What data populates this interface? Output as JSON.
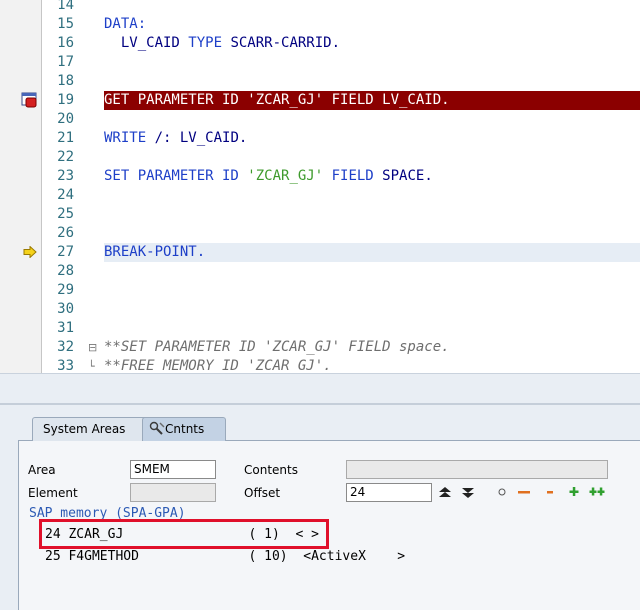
{
  "editor": {
    "lines": [
      {
        "no": "14",
        "tokens": []
      },
      {
        "no": "15",
        "tokens": [
          {
            "t": "DATA:",
            "c": "kw"
          }
        ]
      },
      {
        "no": "16",
        "tokens": [
          {
            "t": "  LV_CAID ",
            "c": "txt"
          },
          {
            "t": "TYPE",
            "c": "kw"
          },
          {
            "t": " SCARR-CARRID.",
            "c": "txt"
          }
        ]
      },
      {
        "no": "17",
        "tokens": []
      },
      {
        "no": "18",
        "tokens": []
      },
      {
        "no": "19",
        "tokens": [
          {
            "t": "GET PARAMETER ID 'ZCAR_GJ' FIELD LV_CAID.",
            "c": "txt"
          }
        ],
        "state": "breakpoint"
      },
      {
        "no": "20",
        "tokens": []
      },
      {
        "no": "21",
        "tokens": [
          {
            "t": "WRITE",
            "c": "kw"
          },
          {
            "t": " /: LV_CAID.",
            "c": "txt"
          }
        ]
      },
      {
        "no": "22",
        "tokens": []
      },
      {
        "no": "23",
        "tokens": [
          {
            "t": "SET PARAMETER ID",
            "c": "kw"
          },
          {
            "t": " ",
            "c": "txt"
          },
          {
            "t": "'ZCAR_GJ'",
            "c": "str"
          },
          {
            "t": " ",
            "c": "txt"
          },
          {
            "t": "FIELD",
            "c": "kw"
          },
          {
            "t": " SPACE.",
            "c": "txt"
          }
        ]
      },
      {
        "no": "24",
        "tokens": []
      },
      {
        "no": "25",
        "tokens": []
      },
      {
        "no": "26",
        "tokens": []
      },
      {
        "no": "27",
        "tokens": [
          {
            "t": "BREAK-POINT.",
            "c": "kw"
          }
        ],
        "state": "current"
      },
      {
        "no": "28",
        "tokens": []
      },
      {
        "no": "29",
        "tokens": []
      },
      {
        "no": "30",
        "tokens": []
      },
      {
        "no": "31",
        "tokens": []
      },
      {
        "no": "32",
        "tokens": [
          {
            "t": "**SET PARAMETER ID 'ZCAR_GJ' FIELD space.",
            "c": "cm"
          }
        ],
        "fold": "⊟"
      },
      {
        "no": "33",
        "tokens": [
          {
            "t": "**FREE MEMORY ID 'ZCAR_GJ'.",
            "c": "cm"
          }
        ],
        "fold": "└"
      }
    ]
  },
  "tabs": {
    "system_areas": "System Areas",
    "contents": "Cntnts"
  },
  "form": {
    "area_label": "Area",
    "area_value": "SMEM",
    "contents_label": "Contents",
    "contents_value": "",
    "element_label": "Element",
    "element_value": "",
    "offset_label": "Offset",
    "offset_value": "24"
  },
  "toolbar": {
    "scroll_up": "⏶",
    "scroll_down": "⏷",
    "circle": "○",
    "minus_red": "−",
    "minus_orange": "−",
    "plus_green": "+",
    "plus_double": "++"
  },
  "memory": {
    "title": "SAP memory (SPA-GPA)",
    "rows": [
      "24 ZCAR_GJ                ( 1)  < >",
      "25 F4GMETHOD              ( 10)  <ActiveX    >"
    ]
  }
}
